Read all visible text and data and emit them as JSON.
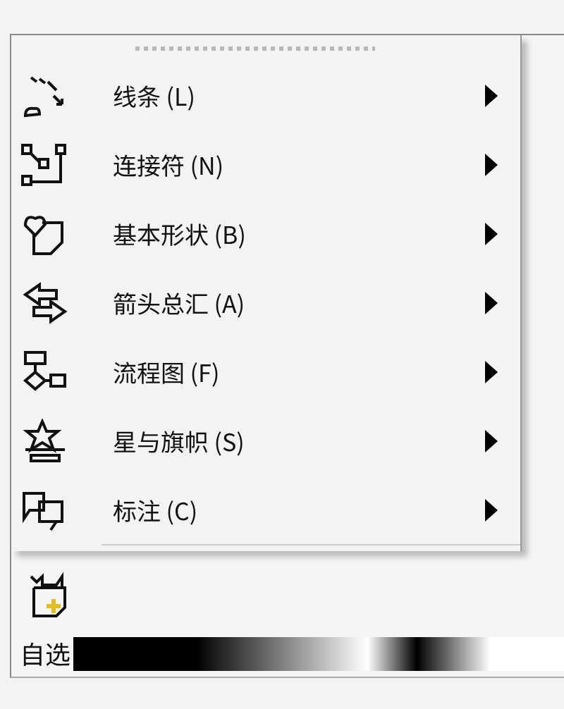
{
  "menu": {
    "items": [
      {
        "label": "线条 (L)",
        "submenu": true
      },
      {
        "label": "连接符 (N)",
        "submenu": true
      },
      {
        "label": "基本形状 (B)",
        "submenu": true
      },
      {
        "label": "箭头总汇 (A)",
        "submenu": true
      },
      {
        "label": "流程图 (F)",
        "submenu": true
      },
      {
        "label": "星与旗帜 (S)",
        "submenu": true
      },
      {
        "label": "标注 (C)",
        "submenu": true
      }
    ]
  },
  "toolbar": {
    "label": "自选"
  }
}
